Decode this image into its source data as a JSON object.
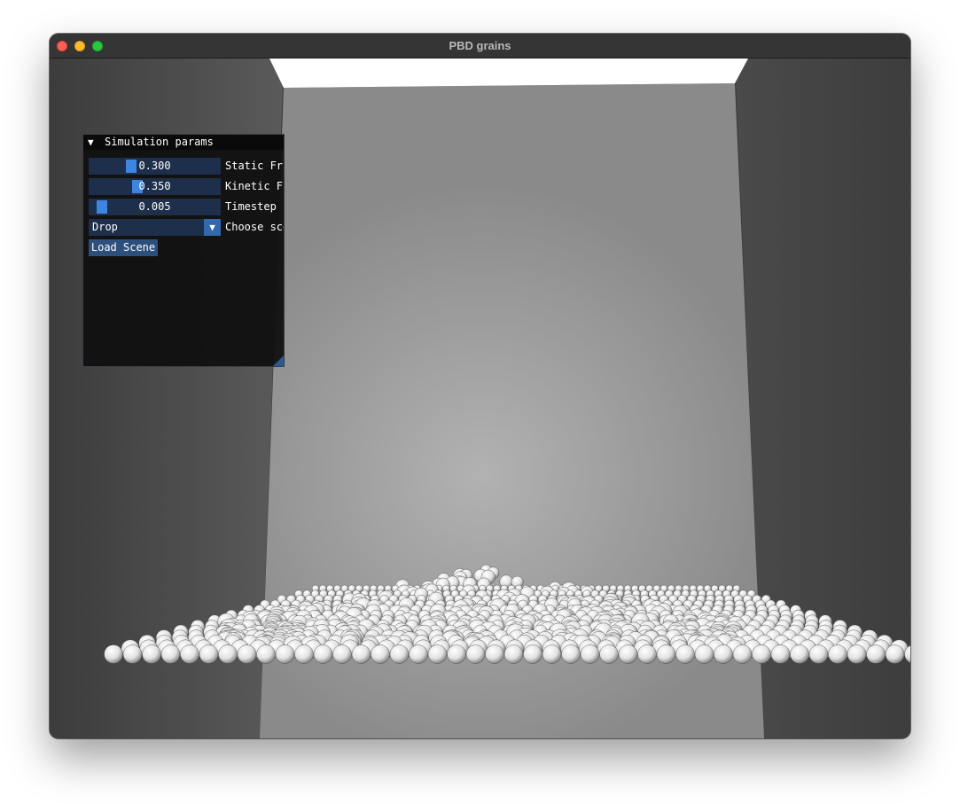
{
  "window": {
    "title": "PBD grains"
  },
  "panel": {
    "title": "Simulation params",
    "collapse_icon": "▼",
    "sliders": [
      {
        "value": "0.300",
        "label": "Static Friction",
        "fraction": 0.3
      },
      {
        "value": "0.350",
        "label": "Kinetic Friction",
        "fraction": 0.35
      },
      {
        "value": "0.005",
        "label": "Timestep",
        "fraction": 0.05
      }
    ],
    "scene_combo": {
      "value": "Drop",
      "label": "Choose scene",
      "arrow_icon": "▼"
    },
    "load_button": "Load Scene"
  },
  "colors": {
    "slider_grab": "#3d85e0",
    "frame_bg": "#1d2f4a",
    "button": "#2d4f7c",
    "panel_bg": "#0f0f0f"
  },
  "icons": [
    "close-icon",
    "minimize-icon",
    "zoom-icon",
    "collapse-arrow-icon",
    "combo-arrow-icon",
    "resize-grip-icon"
  ]
}
